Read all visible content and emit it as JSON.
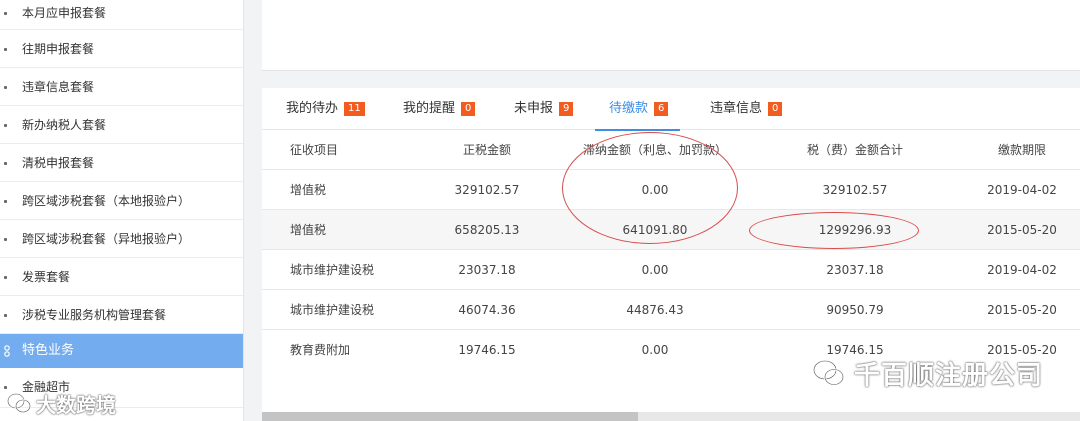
{
  "sidebar": {
    "items": [
      {
        "label": "本月应申报套餐"
      },
      {
        "label": "往期申报套餐"
      },
      {
        "label": "违章信息套餐"
      },
      {
        "label": "新办纳税人套餐"
      },
      {
        "label": "清税申报套餐"
      },
      {
        "label": "跨区域涉税套餐（本地报验户）"
      },
      {
        "label": "跨区域涉税套餐（异地报验户）"
      },
      {
        "label": "发票套餐"
      },
      {
        "label": "涉税专业服务机构管理套餐"
      }
    ],
    "group": {
      "label": "特色业务",
      "icon": "group-icon"
    },
    "after_items": [
      {
        "label": "金融超市"
      }
    ]
  },
  "tabs": [
    {
      "label": "我的待办",
      "count": "11"
    },
    {
      "label": "我的提醒",
      "count": "0"
    },
    {
      "label": "未申报",
      "count": "9"
    },
    {
      "label": "待缴款",
      "count": "6"
    },
    {
      "label": "违章信息",
      "count": "0"
    }
  ],
  "active_tab": "待缴款",
  "table": {
    "headers": [
      "征收项目",
      "正税金额",
      "滞纳金额（利息、加罚款）",
      "税（费）金额合计",
      "缴款期限"
    ],
    "rows": [
      [
        "增值税",
        "329102.57",
        "0.00",
        "329102.57",
        "2019-04-02"
      ],
      [
        "增值税",
        "658205.13",
        "641091.80",
        "1299296.93",
        "2015-05-20"
      ],
      [
        "城市维护建设税",
        "23037.18",
        "0.00",
        "23037.18",
        "2019-04-02"
      ],
      [
        "城市维护建设税",
        "46074.36",
        "44876.43",
        "90950.79",
        "2015-05-20"
      ],
      [
        "教育费附加",
        "19746.15",
        "0.00",
        "19746.15",
        "2015-05-20"
      ]
    ]
  },
  "annotations": {
    "color": "#d94b4b"
  },
  "watermarks": {
    "right": "千百顺注册公司",
    "left": "大数跨境"
  },
  "colors": {
    "accent": "#3d8ee6",
    "badge": "#f25c1f",
    "sidebar_active": "#73acef"
  }
}
